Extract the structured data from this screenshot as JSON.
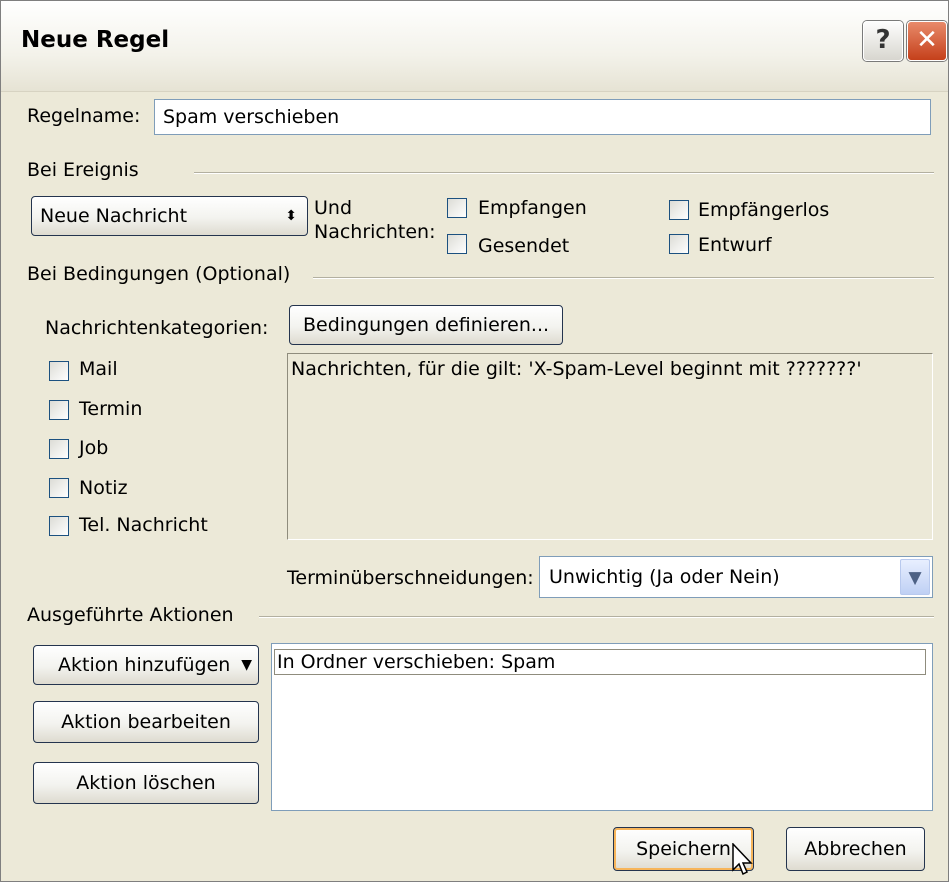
{
  "window": {
    "title": "Neue Regel",
    "help_label": "?",
    "close_label": "✕"
  },
  "rule_name": {
    "label": "Regelname:",
    "value": "Spam verschieben"
  },
  "event_section": {
    "heading": "Bei Ereignis",
    "event_select_value": "Neue Nachricht",
    "and_label": "Und",
    "messages_label": "Nachrichten:",
    "checkboxes": [
      {
        "label": "Empfangen",
        "checked": false
      },
      {
        "label": "Empfängerlos",
        "checked": false
      },
      {
        "label": "Gesendet",
        "checked": false
      },
      {
        "label": "Entwurf",
        "checked": false
      }
    ]
  },
  "conditions_section": {
    "heading": "Bei Bedingungen  (Optional)",
    "categories_label": "Nachrichtenkategorien:",
    "define_button": "Bedingungen definieren...",
    "categories": [
      {
        "label": "Mail",
        "checked": false
      },
      {
        "label": "Termin",
        "checked": false
      },
      {
        "label": "Job",
        "checked": false
      },
      {
        "label": "Notiz",
        "checked": false
      },
      {
        "label": "Tel. Nachricht",
        "checked": false
      }
    ],
    "condition_text": "Nachrichten, für die gilt: 'X-Spam-Level  beginnt mit ???????'",
    "overlap_label": "Terminüberschneidungen:",
    "overlap_value": "Unwichtig (Ja oder Nein)"
  },
  "actions_section": {
    "heading": "Ausgeführte Aktionen",
    "add_button": "Aktion hinzufügen",
    "edit_button": "Aktion bearbeiten",
    "delete_button": "Aktion löschen",
    "items": [
      "In Ordner verschieben: Spam"
    ]
  },
  "footer": {
    "save_button": "Speichern",
    "cancel_button": "Abbrechen"
  }
}
